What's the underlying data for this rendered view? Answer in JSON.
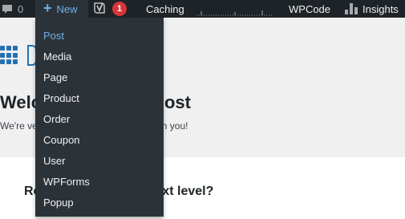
{
  "adminbar": {
    "comments_count": "0",
    "new_label": "New",
    "yoast_count": "1",
    "caching_label": "Caching",
    "wpcode_label": "WPCode",
    "insights_label": "Insights"
  },
  "new_menu": {
    "items": [
      "Post",
      "Media",
      "Page",
      "Product",
      "Order",
      "Coupon",
      "User",
      "WPForms",
      "Popup"
    ]
  },
  "welcome": {
    "title_left": "Welc",
    "title_right": "ost",
    "sub_left": "We're ve",
    "sub_right": "h you!"
  },
  "card": {
    "title_left": "Re",
    "title_right": "ext level?"
  },
  "colors": {
    "adminbar_bg": "#1d2327",
    "submenu_bg": "#2c3338",
    "accent": "#72aee6",
    "badge": "#d63638",
    "logo_blue": "#2271b1"
  }
}
